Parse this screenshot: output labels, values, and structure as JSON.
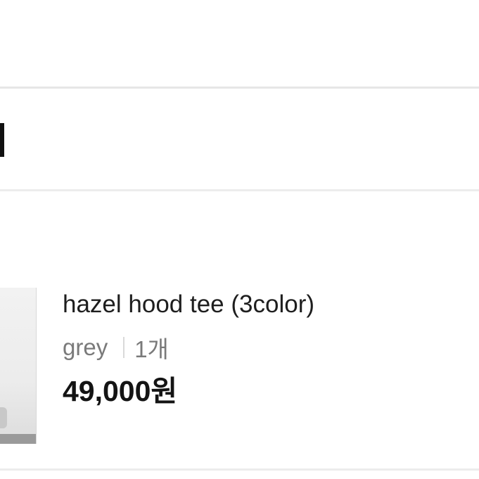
{
  "order_item": {
    "product_name": "hazel hood tee (3color)",
    "option": "grey",
    "quantity": "1개",
    "price": "49,000원"
  }
}
